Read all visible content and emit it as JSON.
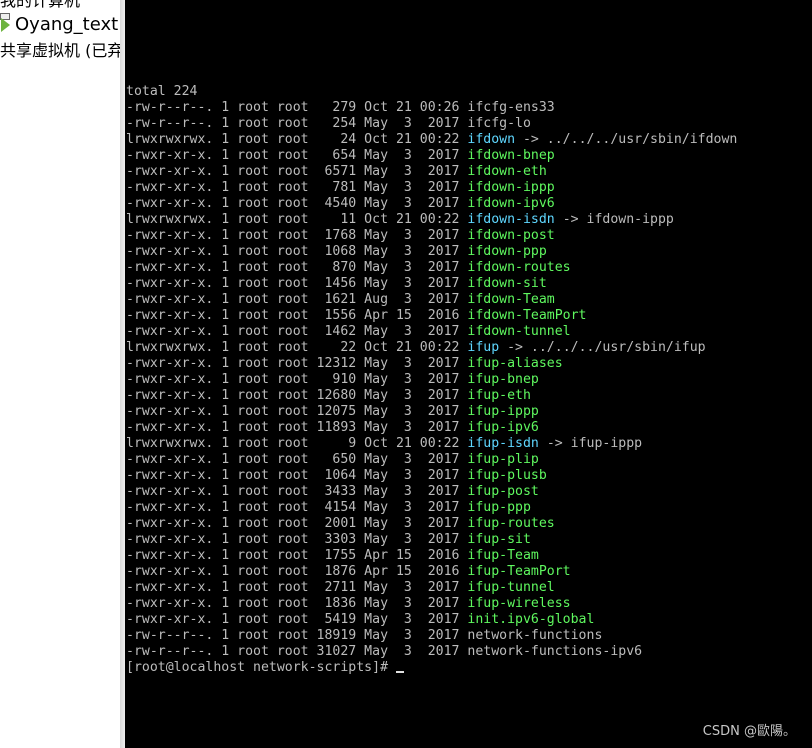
{
  "sidebar": {
    "items": [
      {
        "label": "我的计算机"
      },
      {
        "label": "Oyang_text"
      },
      {
        "label": "共享虚拟机 (已弃用)"
      }
    ]
  },
  "terminal": {
    "total": "total 224",
    "entries": [
      {
        "meta": "-rw-r--r--. 1 root root   279 Oct 21 00:26 ",
        "name": "ifcfg-ens33",
        "link": "",
        "color": "white"
      },
      {
        "meta": "-rw-r--r--. 1 root root   254 May  3  2017 ",
        "name": "ifcfg-lo",
        "link": "",
        "color": "white"
      },
      {
        "meta": "lrwxrwxrwx. 1 root root    24 Oct 21 00:22 ",
        "name": "ifdown",
        "link": " -> ../../../usr/sbin/ifdown",
        "color": "cyan"
      },
      {
        "meta": "-rwxr-xr-x. 1 root root   654 May  3  2017 ",
        "name": "ifdown-bnep",
        "link": "",
        "color": "green"
      },
      {
        "meta": "-rwxr-xr-x. 1 root root  6571 May  3  2017 ",
        "name": "ifdown-eth",
        "link": "",
        "color": "green"
      },
      {
        "meta": "-rwxr-xr-x. 1 root root   781 May  3  2017 ",
        "name": "ifdown-ippp",
        "link": "",
        "color": "green"
      },
      {
        "meta": "-rwxr-xr-x. 1 root root  4540 May  3  2017 ",
        "name": "ifdown-ipv6",
        "link": "",
        "color": "green"
      },
      {
        "meta": "lrwxrwxrwx. 1 root root    11 Oct 21 00:22 ",
        "name": "ifdown-isdn",
        "link": " -> ifdown-ippp",
        "color": "cyan"
      },
      {
        "meta": "-rwxr-xr-x. 1 root root  1768 May  3  2017 ",
        "name": "ifdown-post",
        "link": "",
        "color": "green"
      },
      {
        "meta": "-rwxr-xr-x. 1 root root  1068 May  3  2017 ",
        "name": "ifdown-ppp",
        "link": "",
        "color": "green"
      },
      {
        "meta": "-rwxr-xr-x. 1 root root   870 May  3  2017 ",
        "name": "ifdown-routes",
        "link": "",
        "color": "green"
      },
      {
        "meta": "-rwxr-xr-x. 1 root root  1456 May  3  2017 ",
        "name": "ifdown-sit",
        "link": "",
        "color": "green"
      },
      {
        "meta": "-rwxr-xr-x. 1 root root  1621 Aug  3  2017 ",
        "name": "ifdown-Team",
        "link": "",
        "color": "green"
      },
      {
        "meta": "-rwxr-xr-x. 1 root root  1556 Apr 15  2016 ",
        "name": "ifdown-TeamPort",
        "link": "",
        "color": "green"
      },
      {
        "meta": "-rwxr-xr-x. 1 root root  1462 May  3  2017 ",
        "name": "ifdown-tunnel",
        "link": "",
        "color": "green"
      },
      {
        "meta": "lrwxrwxrwx. 1 root root    22 Oct 21 00:22 ",
        "name": "ifup",
        "link": " -> ../../../usr/sbin/ifup",
        "color": "cyan"
      },
      {
        "meta": "-rwxr-xr-x. 1 root root 12312 May  3  2017 ",
        "name": "ifup-aliases",
        "link": "",
        "color": "green"
      },
      {
        "meta": "-rwxr-xr-x. 1 root root   910 May  3  2017 ",
        "name": "ifup-bnep",
        "link": "",
        "color": "green"
      },
      {
        "meta": "-rwxr-xr-x. 1 root root 12680 May  3  2017 ",
        "name": "ifup-eth",
        "link": "",
        "color": "green"
      },
      {
        "meta": "-rwxr-xr-x. 1 root root 12075 May  3  2017 ",
        "name": "ifup-ippp",
        "link": "",
        "color": "green"
      },
      {
        "meta": "-rwxr-xr-x. 1 root root 11893 May  3  2017 ",
        "name": "ifup-ipv6",
        "link": "",
        "color": "green"
      },
      {
        "meta": "lrwxrwxrwx. 1 root root     9 Oct 21 00:22 ",
        "name": "ifup-isdn",
        "link": " -> ifup-ippp",
        "color": "cyan"
      },
      {
        "meta": "-rwxr-xr-x. 1 root root   650 May  3  2017 ",
        "name": "ifup-plip",
        "link": "",
        "color": "green"
      },
      {
        "meta": "-rwxr-xr-x. 1 root root  1064 May  3  2017 ",
        "name": "ifup-plusb",
        "link": "",
        "color": "green"
      },
      {
        "meta": "-rwxr-xr-x. 1 root root  3433 May  3  2017 ",
        "name": "ifup-post",
        "link": "",
        "color": "green"
      },
      {
        "meta": "-rwxr-xr-x. 1 root root  4154 May  3  2017 ",
        "name": "ifup-ppp",
        "link": "",
        "color": "green"
      },
      {
        "meta": "-rwxr-xr-x. 1 root root  2001 May  3  2017 ",
        "name": "ifup-routes",
        "link": "",
        "color": "green"
      },
      {
        "meta": "-rwxr-xr-x. 1 root root  3303 May  3  2017 ",
        "name": "ifup-sit",
        "link": "",
        "color": "green"
      },
      {
        "meta": "-rwxr-xr-x. 1 root root  1755 Apr 15  2016 ",
        "name": "ifup-Team",
        "link": "",
        "color": "green"
      },
      {
        "meta": "-rwxr-xr-x. 1 root root  1876 Apr 15  2016 ",
        "name": "ifup-TeamPort",
        "link": "",
        "color": "green"
      },
      {
        "meta": "-rwxr-xr-x. 1 root root  2711 May  3  2017 ",
        "name": "ifup-tunnel",
        "link": "",
        "color": "green"
      },
      {
        "meta": "-rwxr-xr-x. 1 root root  1836 May  3  2017 ",
        "name": "ifup-wireless",
        "link": "",
        "color": "green"
      },
      {
        "meta": "-rwxr-xr-x. 1 root root  5419 May  3  2017 ",
        "name": "init.ipv6-global",
        "link": "",
        "color": "green"
      },
      {
        "meta": "-rw-r--r--. 1 root root 18919 May  3  2017 ",
        "name": "network-functions",
        "link": "",
        "color": "white"
      },
      {
        "meta": "-rw-r--r--. 1 root root 31027 May  3  2017 ",
        "name": "network-functions-ipv6",
        "link": "",
        "color": "white"
      }
    ],
    "prompt": "[root@localhost network-scripts]# "
  },
  "watermark": "CSDN @歐陽。",
  "colors": {
    "executable": "#5ff85f",
    "symlink": "#5fd7ff",
    "regular": "#bcbcbc",
    "background": "#000000"
  }
}
